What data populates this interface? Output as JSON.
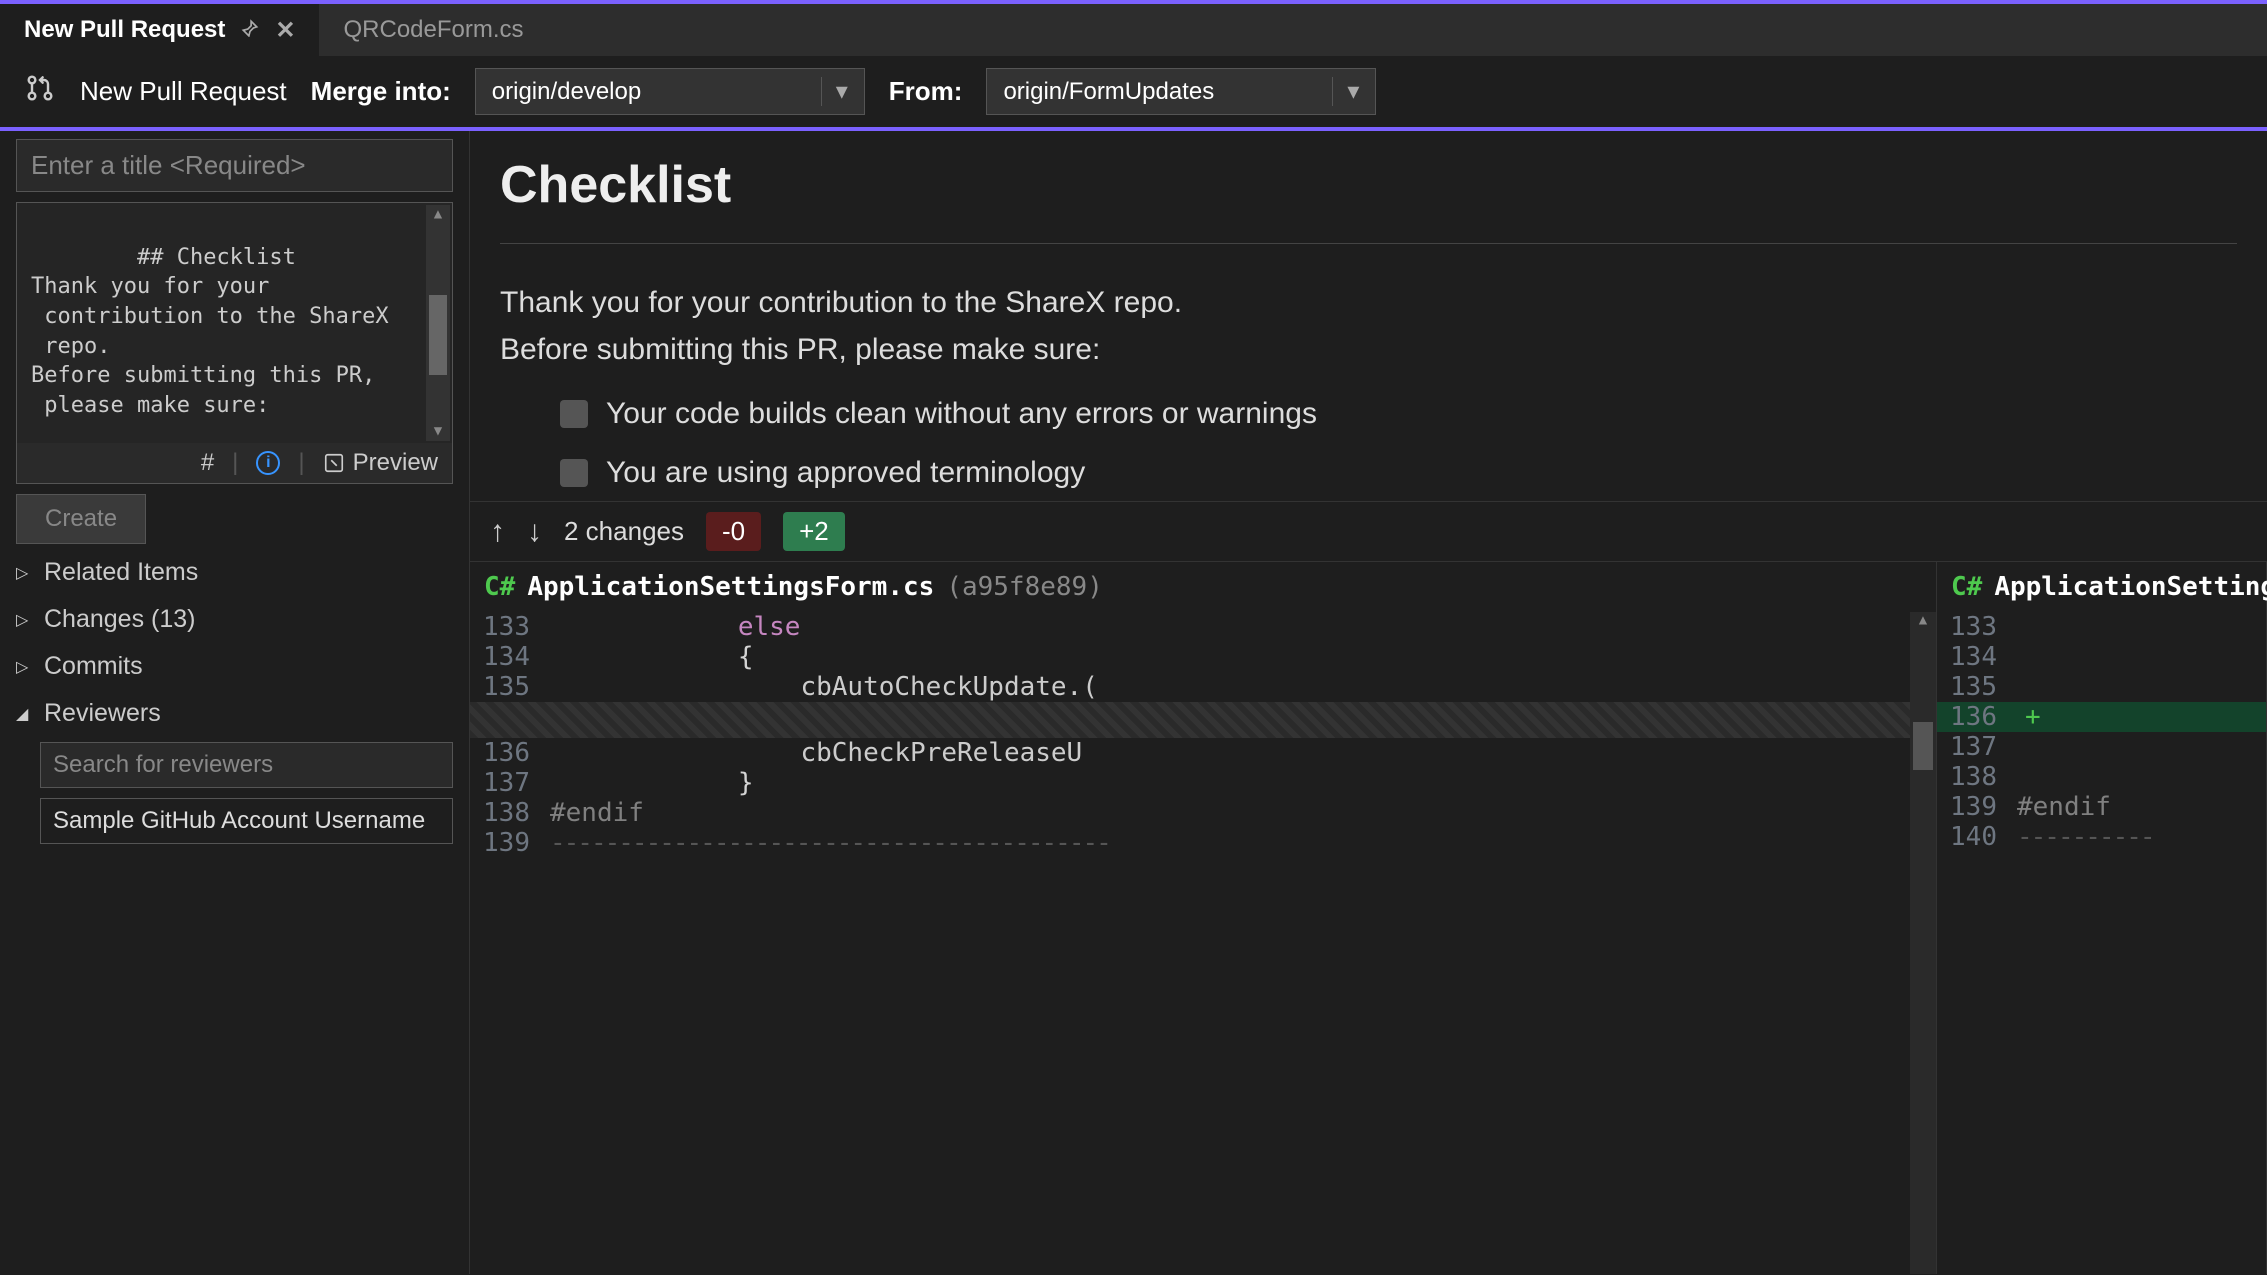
{
  "tabs": {
    "active": "New Pull Request",
    "inactive": "QRCodeForm.cs"
  },
  "toolbar": {
    "title": "New Pull Request",
    "merge_label": "Merge into:",
    "merge_branch": "origin/develop",
    "from_label": "From:",
    "from_branch": "origin/FormUpdates"
  },
  "form": {
    "title_placeholder": "Enter a title <Required>",
    "description": "## Checklist\nThank you for your\n contribution to the ShareX\n repo.\nBefore submitting this PR,\n please make sure:\n\n- [x] Your code builds",
    "preview_label": "Preview",
    "create_label": "Create"
  },
  "tree": {
    "related": "Related Items",
    "changes": "Changes (13)",
    "commits": "Commits",
    "reviewers": "Reviewers",
    "search_placeholder": "Search for reviewers",
    "reviewer_sample": "Sample GitHub Account Username"
  },
  "preview": {
    "heading": "Checklist",
    "para1": "Thank you for your contribution to the ShareX repo.",
    "para2": "Before submitting this PR, please make sure:",
    "check1": "Your code builds clean without any errors or warnings",
    "check2": "You are using approved terminology"
  },
  "diff": {
    "changes_label": "2 changes",
    "removed": "-0",
    "added": "+2",
    "file_left": {
      "lang": "C#",
      "name": "ApplicationSettingsForm.cs",
      "hash": "(a95f8e89)",
      "lines": [
        {
          "n": "133",
          "html": "            <span class='kw'>else</span>"
        },
        {
          "n": "134",
          "html": "            <span class='br'>{</span>"
        },
        {
          "n": "135",
          "html": "                cbAutoCheckUpdate.("
        },
        {
          "hatch": true
        },
        {
          "n": "136",
          "html": "                cbCheckPreReleaseU"
        },
        {
          "n": "137",
          "html": "            <span class='br'>}</span>"
        },
        {
          "n": "138",
          "html": "<span class='pp'>#endif</span>"
        },
        {
          "n": "139",
          "html": "<span class='dashline'>-----------------------------------------</span>"
        }
      ]
    },
    "file_right": {
      "lang": "C#",
      "name": "ApplicationSettingsForm",
      "lines": [
        {
          "n": "133"
        },
        {
          "n": "134"
        },
        {
          "n": "135"
        },
        {
          "n": "136",
          "added": true,
          "plus": "+"
        },
        {
          "n": "137"
        },
        {
          "n": "138"
        },
        {
          "n": "139",
          "html": "<span class='pp'>#endif</span>"
        },
        {
          "n": "140",
          "html": "<span class='dashline'>----------</span>"
        }
      ]
    }
  }
}
